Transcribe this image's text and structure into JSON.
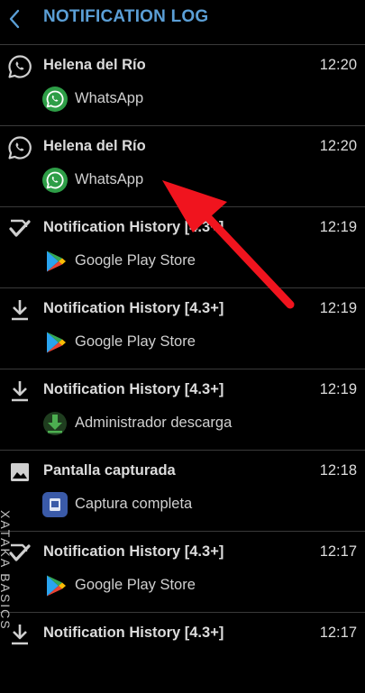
{
  "appbar": {
    "title": "NOTIFICATION LOG",
    "accent_color": "#5b9fd6"
  },
  "notifications": [
    {
      "title": "Helena del Río",
      "time": "12:20",
      "app": "WhatsApp",
      "type_icon": "whatsapp-icon",
      "app_icon": "whatsapp-app-icon"
    },
    {
      "title": "Helena del Río",
      "time": "12:20",
      "app": "WhatsApp",
      "type_icon": "whatsapp-icon",
      "app_icon": "whatsapp-app-icon"
    },
    {
      "title": "Notification History [4.3+]",
      "time": "12:19",
      "app": "Google Play Store",
      "type_icon": "checkmark-icon",
      "app_icon": "google-play-icon"
    },
    {
      "title": "Notification History [4.3+]",
      "time": "12:19",
      "app": "Google Play Store",
      "type_icon": "download-icon",
      "app_icon": "google-play-icon"
    },
    {
      "title": "Notification History [4.3+]",
      "time": "12:19",
      "app": "Administrador descarga",
      "type_icon": "download-icon",
      "app_icon": "download-manager-icon"
    },
    {
      "title": "Pantalla capturada",
      "time": "12:18",
      "app": "Captura completa",
      "type_icon": "image-icon",
      "app_icon": "screenshot-app-icon"
    },
    {
      "title": "Notification History [4.3+]",
      "time": "12:17",
      "app": "Google Play Store",
      "type_icon": "checkmark-icon",
      "app_icon": "google-play-icon"
    },
    {
      "title": "Notification History [4.3+]",
      "time": "12:17",
      "app": "",
      "type_icon": "download-icon",
      "app_icon": ""
    }
  ],
  "watermark": {
    "text": "XATAKA BASICS"
  },
  "colors": {
    "background": "#000000",
    "divider": "#3a3a3a",
    "whatsapp_green": "#2e9e47",
    "arrow_red": "#f0141e"
  }
}
